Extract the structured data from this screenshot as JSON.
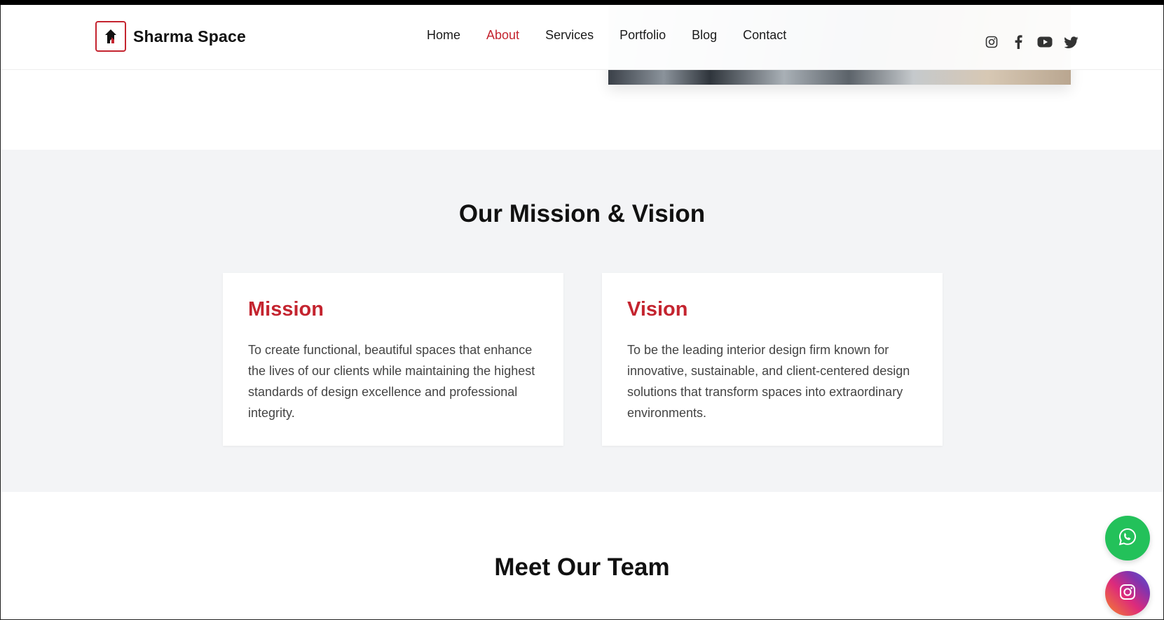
{
  "brand": {
    "name": "Sharma Space",
    "logo_icon": "house-icon",
    "accent": "#c4242f"
  },
  "nav": {
    "items": [
      {
        "label": "Home",
        "active": false
      },
      {
        "label": "About",
        "active": true
      },
      {
        "label": "Services",
        "active": false
      },
      {
        "label": "Portfolio",
        "active": false
      },
      {
        "label": "Blog",
        "active": false
      },
      {
        "label": "Contact",
        "active": false
      }
    ]
  },
  "socials": [
    "instagram-icon",
    "facebook-icon",
    "youtube-icon",
    "twitter-icon"
  ],
  "mission_section": {
    "title": "Our Mission & Vision",
    "cards": [
      {
        "heading": "Mission",
        "text": "To create functional, beautiful spaces that enhance the lives of our clients while maintaining the highest standards of design excellence and professional integrity."
      },
      {
        "heading": "Vision",
        "text": "To be the leading interior design firm known for innovative, sustainable, and client-centered design solutions that transform spaces into extraordinary environments."
      }
    ]
  },
  "team_section": {
    "title": "Meet Our Team"
  },
  "floating_buttons": {
    "whatsapp": {
      "icon": "whatsapp-icon",
      "color": "#23c15a"
    },
    "instagram": {
      "icon": "instagram-icon"
    }
  }
}
